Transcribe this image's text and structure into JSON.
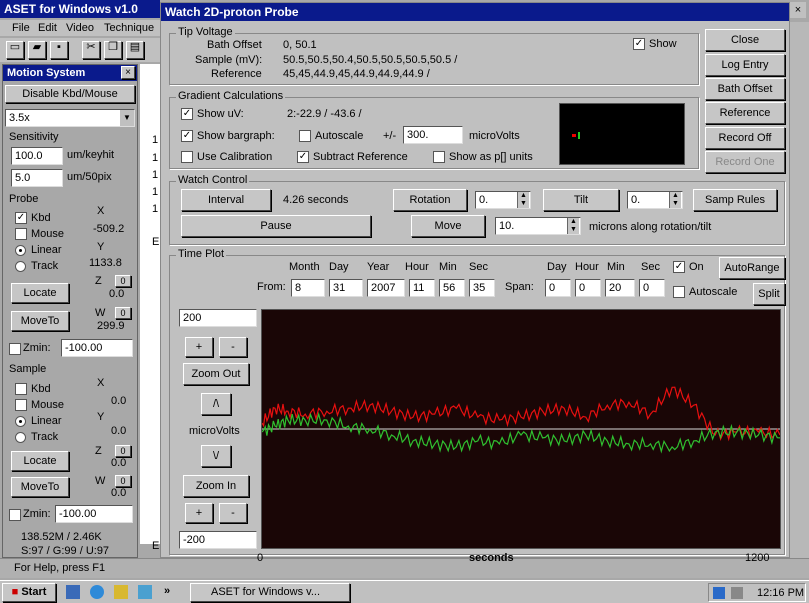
{
  "aset": {
    "title": "ASET for Windows v1.0",
    "menu": [
      "File",
      "Edit",
      "Video",
      "Technique"
    ],
    "status": "For Help, press F1",
    "bg_lines": [
      "1",
      "1",
      "1",
      "1",
      "1",
      "E",
      "E"
    ]
  },
  "motion": {
    "title": "Motion System",
    "disable_btn": "Disable Kbd/Mouse",
    "zoom_select": "3.5x",
    "sensitivity_label": "Sensitivity",
    "keyhit_value": "100.0",
    "keyhit_unit": "um/keyhit",
    "pix_value": "5.0",
    "pix_unit": "um/50pix",
    "probe": {
      "label": "Probe",
      "kbd": "Kbd",
      "mouse": "Mouse",
      "linear": "Linear",
      "track": "Track",
      "x_label": "X",
      "x_val": "-509.2",
      "y_label": "Y",
      "y_val": "1133.8",
      "z_label": "Z",
      "z_val": "0.0",
      "w_label": "W",
      "w_val": "299.9",
      "locate": "Locate",
      "moveto": "MoveTo",
      "zmin_label": "Zmin:",
      "zmin_val": "-100.00",
      "z_spin": "0",
      "w_spin": "0"
    },
    "sample": {
      "label": "Sample",
      "kbd": "Kbd",
      "mouse": "Mouse",
      "linear": "Linear",
      "track": "Track",
      "x_label": "X",
      "x_val": "0.0",
      "y_label": "Y",
      "y_val": "0.0",
      "z_label": "Z",
      "z_val": "0.0",
      "w_label": "W",
      "w_val": "0.0",
      "locate": "Locate",
      "moveto": "MoveTo",
      "zmin_label": "Zmin:",
      "zmin_val": "-100.00",
      "z_spin": "0",
      "w_spin": "0"
    },
    "stat1": "138.52M / 2.46K",
    "stat2": "S:97 / G:99 / U:97"
  },
  "watch": {
    "title": "Watch 2D-proton Probe",
    "close": "Close",
    "log_entry": "Log Entry",
    "bath_offset_btn": "Bath Offset",
    "reference_btn": "Reference",
    "record_off": "Record Off",
    "record_one": "Record One",
    "tip": {
      "label": "Tip Voltage",
      "bath_label": "Bath Offset",
      "bath_val": "0, 50.1",
      "sample_label": "Sample (mV):",
      "sample_val": "50.5,50.5,50.4,50.5,50.5,50.5,50.5 /",
      "ref_label": "Reference",
      "ref_val": "45,45,44.9,45,44.9,44.9,44.9 /",
      "show": "Show"
    },
    "grad": {
      "label": "Gradient Calculations",
      "show_uv": "Show uV:",
      "uv_val": "2:-22.9 / -43.6 /",
      "show_bar": "Show bargraph:",
      "autoscale": "Autoscale",
      "pm": "+/-",
      "pm_val": "300.",
      "microvolts": "microVolts",
      "use_cal": "Use Calibration",
      "sub_ref": "Subtract Reference",
      "show_p": "Show as p[] units"
    },
    "control": {
      "label": "Watch Control",
      "interval": "Interval",
      "seconds": "4.26 seconds",
      "rotation": "Rotation",
      "rot_val": "0.",
      "tilt": "Tilt",
      "tilt_val": "0.",
      "samp_rules": "Samp Rules",
      "pause": "Pause",
      "move": "Move",
      "move_val": "10.",
      "move_unit": "microns along rotation/tilt"
    },
    "plot": {
      "label": "Time Plot",
      "h_month": "Month",
      "h_day": "Day",
      "h_year": "Year",
      "h_hour": "Hour",
      "h_min": "Min",
      "h_sec": "Sec",
      "from": "From:",
      "month": "8",
      "day": "31",
      "year": "2007",
      "hour": "11",
      "min": "56",
      "sec": "35",
      "span": "Span:",
      "s_h_day": "Day",
      "s_h_hour": "Hour",
      "s_h_min": "Min",
      "s_h_sec": "Sec",
      "s_day": "0",
      "s_hour": "0",
      "s_min": "20",
      "s_sec": "0",
      "on": "On",
      "autorange": "AutoRange",
      "autoscale": "Autoscale",
      "split": "Split",
      "ymax": "200",
      "ymin": "-200",
      "plus": "+",
      "minus": "-",
      "zoom_out": "Zoom Out",
      "zoom_in": "Zoom In",
      "up": "/\\",
      "down": "\\/",
      "ylabel": "microVolts",
      "xlabel": "seconds",
      "x0": "0",
      "x1": "1200"
    }
  },
  "taskbar": {
    "start": "Start",
    "task": "ASET for Windows v...",
    "chevron": "»",
    "time": "12:16 PM"
  },
  "chart_data": {
    "type": "line",
    "xlabel": "seconds",
    "ylabel": "microVolts",
    "xlim": [
      0,
      1200
    ],
    "ylim": [
      -200,
      200
    ],
    "series": [
      {
        "color": "#e81010",
        "x": [
          0,
          30,
          60,
          100,
          150,
          200,
          250,
          300,
          350,
          400,
          450,
          500,
          550,
          600,
          650,
          700,
          750,
          800,
          850,
          900,
          950,
          1000,
          1050,
          1100,
          1150,
          1200
        ],
        "values": [
          10,
          35,
          30,
          25,
          30,
          35,
          40,
          30,
          20,
          25,
          35,
          20,
          15,
          20,
          30,
          35,
          20,
          40,
          45,
          25,
          70,
          40,
          -10,
          -5,
          -5,
          -10
        ]
      },
      {
        "color": "#30c030",
        "x": [
          0,
          30,
          60,
          100,
          150,
          200,
          250,
          300,
          350,
          400,
          450,
          500,
          550,
          600,
          650,
          700,
          750,
          800,
          850,
          900,
          950,
          1000,
          1050,
          1100,
          1150,
          1200
        ],
        "values": [
          -5,
          5,
          15,
          15,
          15,
          5,
          0,
          -10,
          -20,
          -25,
          -30,
          -20,
          -25,
          -10,
          -15,
          -20,
          -10,
          -20,
          -25,
          -25,
          -30,
          -20,
          -5,
          -5,
          -10,
          -15
        ]
      }
    ]
  }
}
